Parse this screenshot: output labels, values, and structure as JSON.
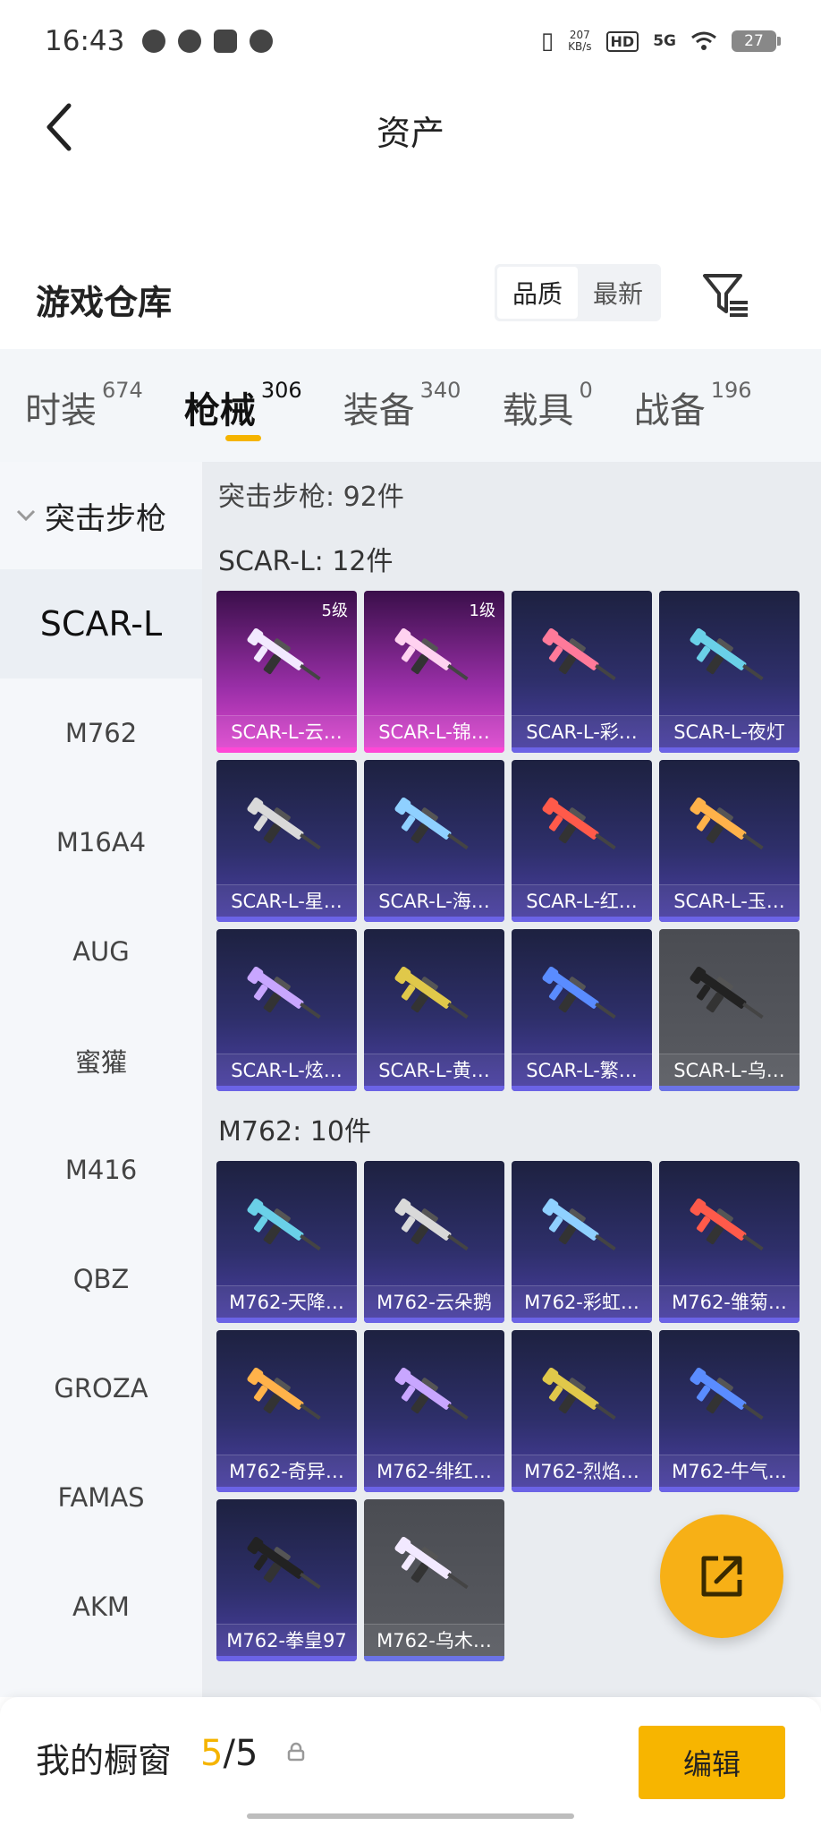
{
  "status_bar": {
    "time": "16:43",
    "net_speed_value": "207",
    "net_speed_unit": "KB/s",
    "hd_badge": "HD",
    "signal": "5G",
    "battery": "27"
  },
  "header": {
    "title": "资产"
  },
  "section": {
    "title": "游戏仓库",
    "sort_options": [
      "品质",
      "最新"
    ],
    "active_sort": "品质"
  },
  "tabs": [
    {
      "label": "时装",
      "count": "674"
    },
    {
      "label": "枪械",
      "count": "306"
    },
    {
      "label": "装备",
      "count": "340"
    },
    {
      "label": "载具",
      "count": "0"
    },
    {
      "label": "战备",
      "count": "196"
    }
  ],
  "active_tab": "枪械",
  "side_nav": {
    "group": "突击步枪",
    "items": [
      "SCAR-L",
      "M762",
      "M16A4",
      "AUG",
      "蜜獾",
      "M416",
      "QBZ",
      "GROZA",
      "FAMAS",
      "AKM"
    ],
    "active_item": "SCAR-L"
  },
  "content": {
    "group_title": "突击步枪: 92件",
    "subgroups": [
      {
        "title": "SCAR-L: 12件",
        "items": [
          {
            "name": "SCAR-L-云…",
            "level": "5级",
            "style": "pink"
          },
          {
            "name": "SCAR-L-锦…",
            "level": "1级",
            "style": "pink"
          },
          {
            "name": "SCAR-L-彩…",
            "style": "purple"
          },
          {
            "name": "SCAR-L-夜灯",
            "style": "purple"
          },
          {
            "name": "SCAR-L-星…",
            "style": "purple"
          },
          {
            "name": "SCAR-L-海…",
            "style": "purple"
          },
          {
            "name": "SCAR-L-红…",
            "style": "purple"
          },
          {
            "name": "SCAR-L-玉…",
            "style": "purple"
          },
          {
            "name": "SCAR-L-炫…",
            "style": "purple"
          },
          {
            "name": "SCAR-L-黄…",
            "style": "purple"
          },
          {
            "name": "SCAR-L-繁…",
            "style": "purple"
          },
          {
            "name": "SCAR-L-乌…",
            "style": "gray"
          }
        ]
      },
      {
        "title": "M762: 10件",
        "items": [
          {
            "name": "M762-天降…",
            "style": "purple"
          },
          {
            "name": "M762-云朵鹅",
            "style": "purple"
          },
          {
            "name": "M762-彩虹…",
            "style": "purple"
          },
          {
            "name": "M762-雏菊…",
            "style": "purple"
          },
          {
            "name": "M762-奇异…",
            "style": "purple"
          },
          {
            "name": "M762-绯红…",
            "style": "purple"
          },
          {
            "name": "M762-烈焰…",
            "style": "purple"
          },
          {
            "name": "M762-牛气…",
            "style": "purple"
          },
          {
            "name": "M762-拳皇97",
            "style": "purple"
          },
          {
            "name": "M762-乌木…",
            "style": "gray"
          }
        ]
      }
    ]
  },
  "bottom_bar": {
    "label": "我的橱窗",
    "current": "5",
    "separator": "/",
    "max": "5",
    "edit_label": "编辑"
  },
  "colors": {
    "accent": "#f5b400",
    "card_purple": "#2e2f6a",
    "card_pink": "#e24ad1",
    "card_gray": "#5a5c62"
  }
}
